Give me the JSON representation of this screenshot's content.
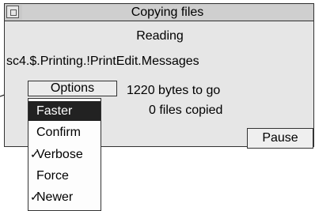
{
  "window": {
    "title": "Copying files",
    "status": "Reading",
    "path": "sc4.$.Printing.!PrintEdit.Messages",
    "bytes_to_go": "1220 bytes to go",
    "files_copied": "0 files copied",
    "pause_label": "Pause"
  },
  "options_button": {
    "label": "Options"
  },
  "menu": {
    "items": [
      {
        "label": "Faster",
        "selected": true,
        "ticked": false
      },
      {
        "label": "Confirm",
        "selected": false,
        "ticked": false
      },
      {
        "label": "Verbose",
        "selected": false,
        "ticked": true
      },
      {
        "label": "Force",
        "selected": false,
        "ticked": false
      },
      {
        "label": "Newer",
        "selected": false,
        "ticked": true
      }
    ],
    "tick_glyph": "✓"
  }
}
